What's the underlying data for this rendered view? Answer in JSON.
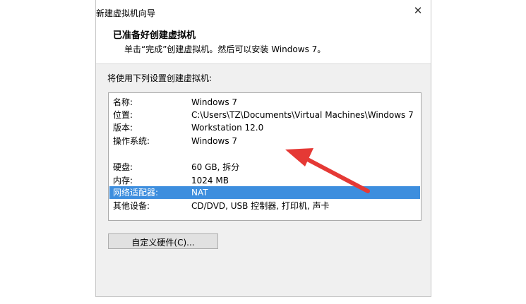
{
  "window": {
    "title": "新建虚拟机向导",
    "close_glyph": "✕"
  },
  "header": {
    "title": "已准备好创建虚拟机",
    "subtitle": "单击“完成”创建虚拟机。然后可以安装 Windows 7。"
  },
  "settings": {
    "intro": "将使用下列设置创建虚拟机:",
    "rows": [
      {
        "label": "名称:",
        "value": "Windows 7"
      },
      {
        "label": "位置:",
        "value": "C:\\Users\\TZ\\Documents\\Virtual Machines\\Windows 7"
      },
      {
        "label": "版本:",
        "value": "Workstation 12.0"
      },
      {
        "label": "操作系统:",
        "value": "Windows 7"
      },
      {
        "label": "硬盘:",
        "value": "60 GB, 拆分"
      },
      {
        "label": "内存:",
        "value": "1024 MB"
      },
      {
        "label": "网络适配器:",
        "value": "NAT",
        "selected": true
      },
      {
        "label": "其他设备:",
        "value": "CD/DVD, USB 控制器, 打印机, 声卡"
      }
    ]
  },
  "buttons": {
    "customize_label": "自定义硬件(C)..."
  },
  "colors": {
    "selection": "#3d8ede",
    "annotation_arrow": "#e53935"
  }
}
